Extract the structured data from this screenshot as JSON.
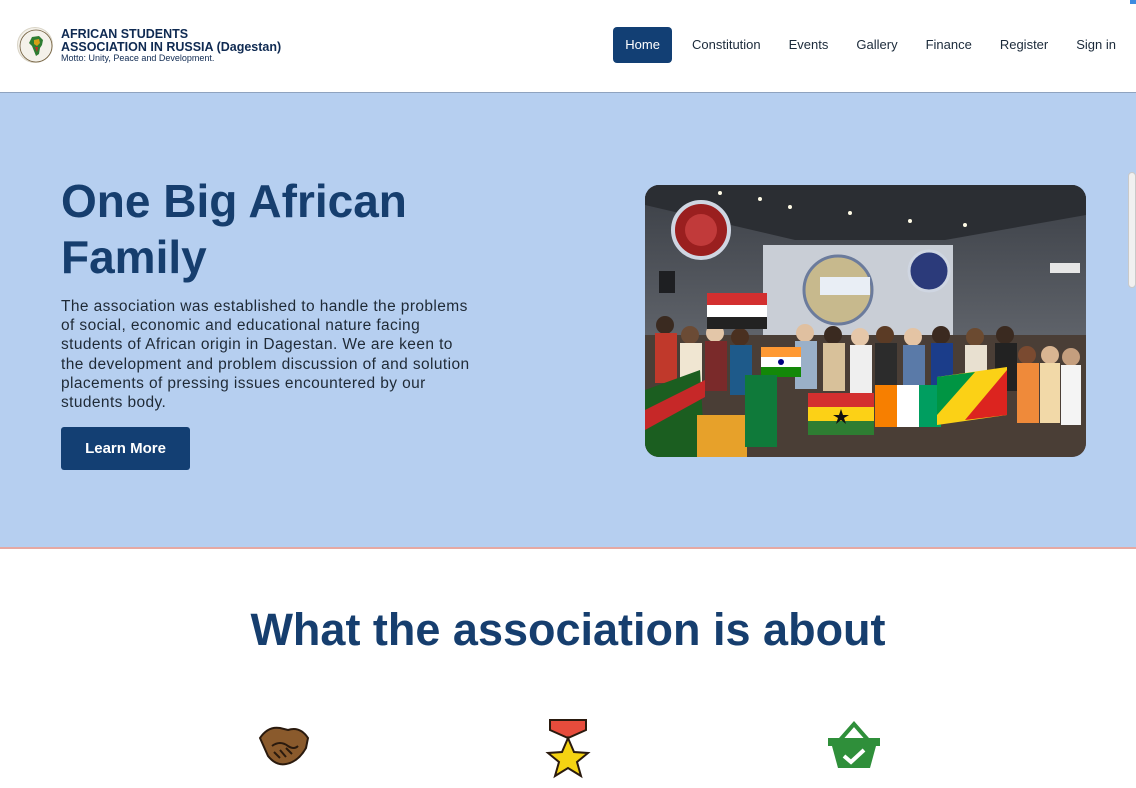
{
  "brand": {
    "title_line1": "AFRICAN STUDENTS",
    "title_line2": "ASSOCIATION IN RUSSIA (Dagestan)",
    "motto": "Motto: Unity, Peace and Development.",
    "logo_icon": "africa-map-seal-icon"
  },
  "nav": {
    "items": [
      {
        "label": "Home",
        "active": true
      },
      {
        "label": "Constitution"
      },
      {
        "label": "Events"
      },
      {
        "label": "Gallery"
      },
      {
        "label": "Finance"
      },
      {
        "label": "Register"
      },
      {
        "label": "Sign in"
      }
    ]
  },
  "hero": {
    "title": "One Big African Family",
    "text": "The association was established to handle the problems of social, economic and educational nature facing students of African origin in Dagestan. We are keen to the development and problem discussion of and solution placements of pressing issues encountered by our students body.",
    "button_label": "Learn More",
    "photo": "group-photo-with-flags"
  },
  "about": {
    "title": "What the association is about",
    "icons": [
      "handshake-icon",
      "medal-icon",
      "basket-check-icon"
    ]
  },
  "colors": {
    "primary": "#133f73",
    "hero_bg": "#b6cff0",
    "heading": "#163e6e"
  }
}
